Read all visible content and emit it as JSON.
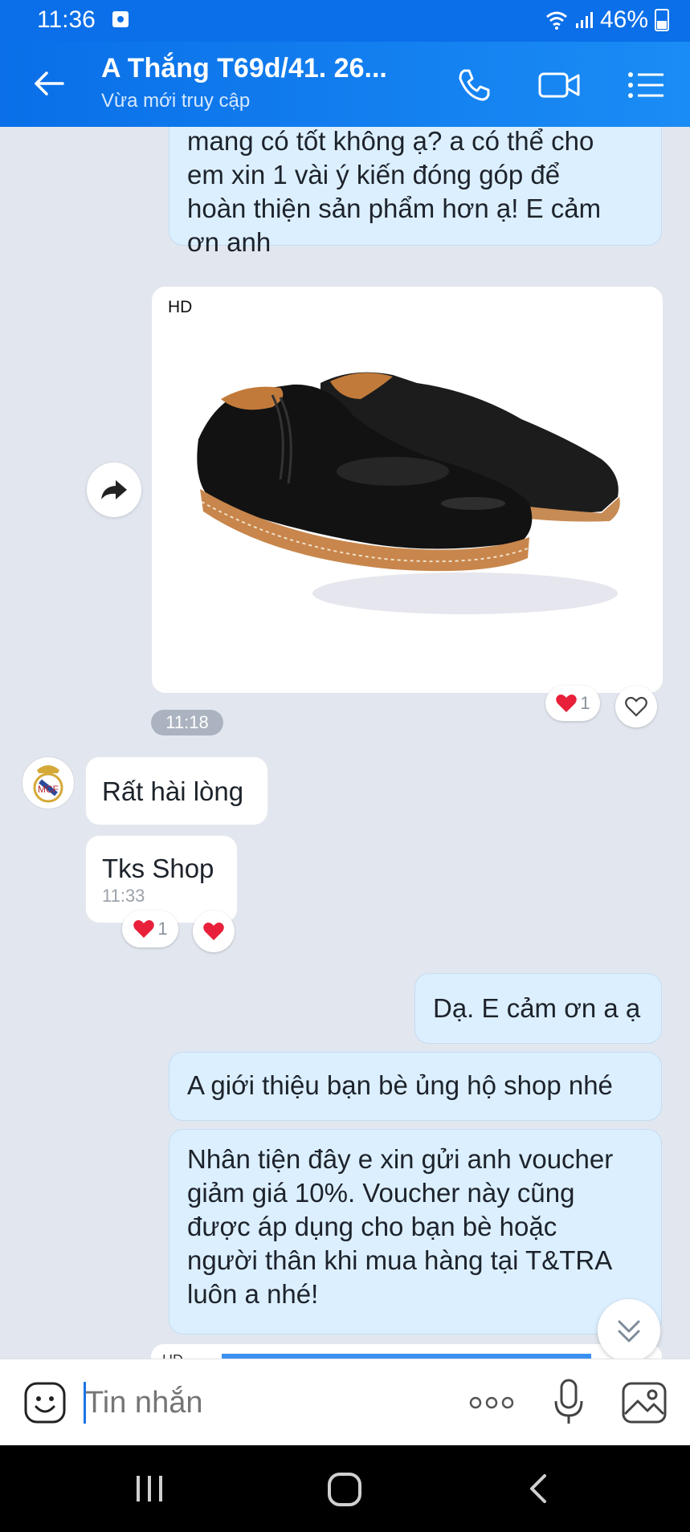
{
  "status_bar": {
    "time": "11:36",
    "battery": "46%"
  },
  "header": {
    "title": "A Thắng T69d/41. 26...",
    "subtitle": "Vừa mới truy cập"
  },
  "messages": {
    "m1_lines": [
      "mang có tốt không ạ? a có thể cho",
      "em xin 1 vài ý kiến đóng góp để",
      "hoàn thiện sản phẩm hơn ạ! E cảm",
      "ơn anh"
    ],
    "image_badge": "HD",
    "image_like_count": "1",
    "time_pill": "11:18",
    "m2": "Rất hài lòng",
    "m3": "Tks Shop",
    "m3_time": "11:33",
    "m3_like_count": "1",
    "m4": "Dạ. E cảm ơn a ạ",
    "m5": "A giới thiệu bạn bè ủng hộ shop nhé",
    "m6_lines": [
      "Nhân tiện đây e xin gửi anh voucher",
      "giảm giá 10%. Voucher này cũng",
      "được áp dụng cho bạn bè hoặc",
      "người thân khi mua hàng tại T&TRA",
      "luôn a nhé!"
    ],
    "partial_label": "HD"
  },
  "input": {
    "placeholder": "Tin nhắn"
  },
  "colors": {
    "header": "#0a6fe8",
    "outgoing_bubble": "#dcefff",
    "incoming_bubble": "#ffffff",
    "background": "#e2e7ef",
    "heart": "#e8203a"
  }
}
